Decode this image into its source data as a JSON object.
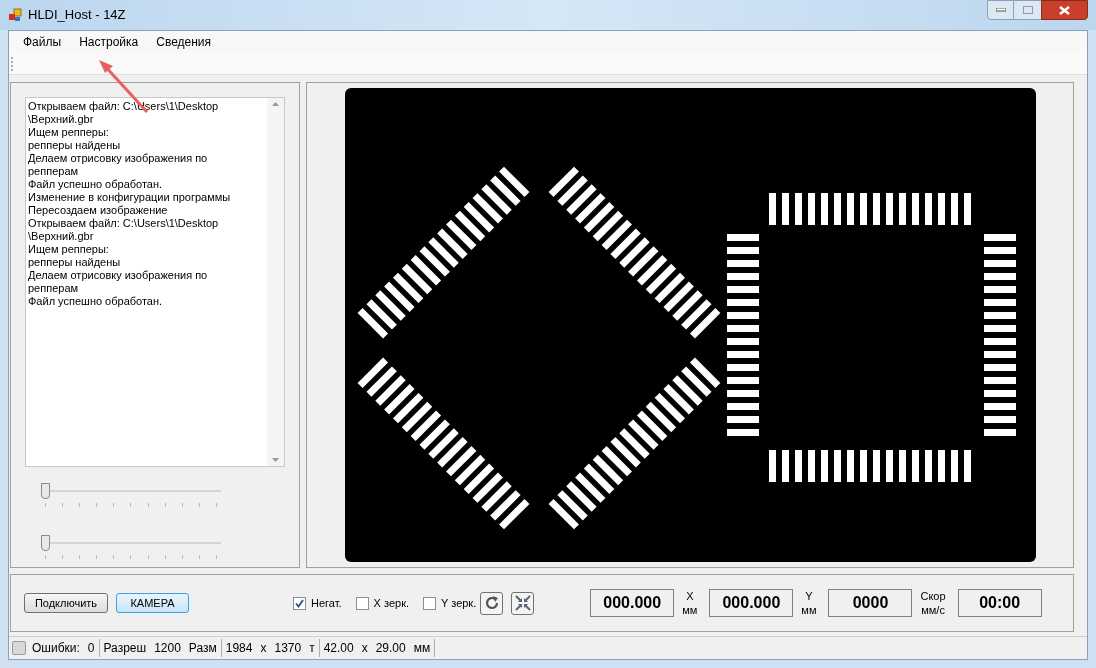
{
  "window": {
    "title": "HLDI_Host - 14Z"
  },
  "menu": [
    "Файлы",
    "Настройка",
    "Сведения"
  ],
  "log": [
    "Открываем файл: C:\\Users\\1\\Desktop",
    "\\Верхний.gbr",
    "Ищем репперы:",
    "репперы найдены",
    "Делаем отрисовку изображения по",
    "репперам",
    "Файл успешно обработан.",
    "Изменение в конфигурации программы",
    "Пересоздаем изображение",
    "Открываем файл: C:\\Users\\1\\Desktop",
    "\\Верхний.gbr",
    "Ищем репперы:",
    "репперы найдены",
    "Делаем отрисовку изображения по",
    "репперам",
    "Файл успешно обработан."
  ],
  "sliders": [
    {
      "level": 0
    },
    {
      "level": 0
    }
  ],
  "buttons": [
    "Подключить",
    "КАМЕРА"
  ],
  "checkboxes": [
    {
      "label": "Негат.",
      "checked": true
    },
    {
      "label": "X зерк.",
      "checked": false
    },
    {
      "label": "Y зерк.",
      "checked": false
    }
  ],
  "readouts": [
    {
      "value": "000.000",
      "unit_top": "X",
      "unit_bottom": "мм"
    },
    {
      "value": "000.000",
      "unit_top": "Y",
      "unit_bottom": "мм"
    },
    {
      "value": "0000",
      "unit_top": "Скор",
      "unit_bottom": "мм/с"
    },
    {
      "value": "00:00"
    }
  ],
  "status_bar": {
    "errors_checked": false,
    "sections": [
      [
        "Ошибки:",
        "0"
      ],
      [
        "Разреш",
        "1200",
        "Разм"
      ],
      [
        "1984",
        "x",
        "1370",
        "т"
      ],
      [
        "42.00",
        "x",
        "29.00",
        "мм"
      ]
    ]
  }
}
